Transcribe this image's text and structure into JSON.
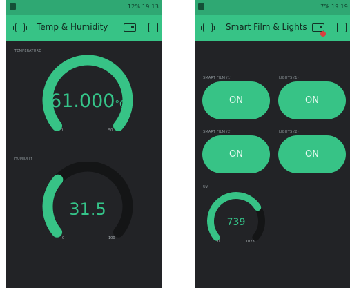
{
  "colors": {
    "accent": "#37c386",
    "status_bar": "#2fa873",
    "background": "#222326",
    "gauge_track": "#141516",
    "gauge_value_text": "#35c489"
  },
  "left_screen": {
    "status_bar": {
      "text": "12% 19:13"
    },
    "app_bar": {
      "title": "Temp & Humidity",
      "left_icon": "dashboard-icon",
      "device_icon": "device-icon",
      "square_icon": "square-icon"
    },
    "temperature_gauge": {
      "label": "TEMPERATURE",
      "value_text": "61.000",
      "unit": "°C",
      "value": 61,
      "min": 0,
      "max": 50,
      "min_label": "0",
      "max_label": "50"
    },
    "humidity_gauge": {
      "label": "HUMIDITY",
      "value_text": "31.5",
      "value": 31.5,
      "min": 0,
      "max": 100,
      "min_label": "0",
      "max_label": "100"
    }
  },
  "right_screen": {
    "status_bar": {
      "text": "7% 19:19"
    },
    "app_bar": {
      "title": "Smart Film & Lights",
      "left_icon": "dashboard-icon",
      "device_icon": "device-icon",
      "square_icon": "square-icon"
    },
    "buttons": [
      {
        "label": "SMART FILM (1)",
        "state": "ON"
      },
      {
        "label": "LIGHTS (1)",
        "state": "ON"
      },
      {
        "label": "SMART FILM (2)",
        "state": "ON"
      },
      {
        "label": "LIGHTS (2)",
        "state": "ON"
      }
    ],
    "uv_gauge": {
      "label": "UV",
      "value_text": "739",
      "value": 739,
      "min": 0,
      "max": 1023,
      "min_label": "0",
      "max_label": "1023"
    }
  }
}
